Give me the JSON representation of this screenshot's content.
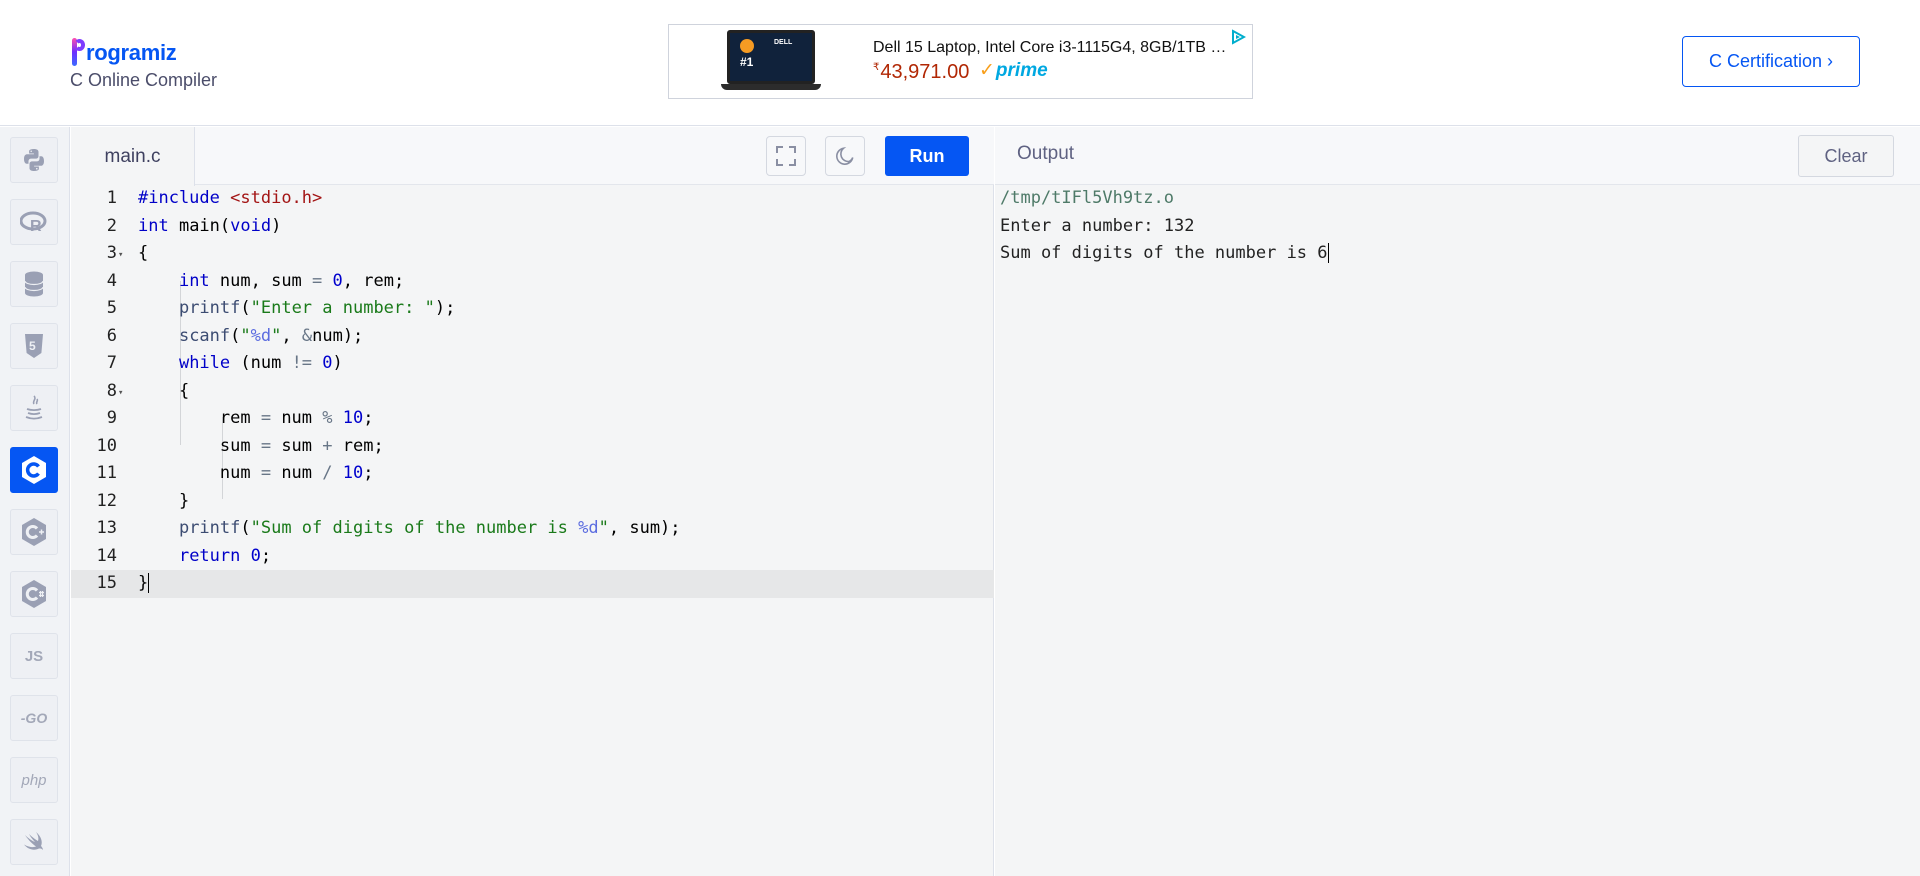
{
  "header": {
    "logo_text": "rogramiz",
    "subtitle": "C Online Compiler",
    "certification_label": "C Certification ›"
  },
  "ad": {
    "title": "Dell 15 Laptop, Intel Core i3-1115G4, 8GB/1TB …",
    "currency": "₹",
    "price": "43,971.00",
    "prime": "prime",
    "badge_text": "#1",
    "brand": "DELL"
  },
  "sidebar": {
    "languages": [
      {
        "name": "python",
        "active": false
      },
      {
        "name": "r",
        "active": false
      },
      {
        "name": "sql",
        "active": false
      },
      {
        "name": "html",
        "active": false
      },
      {
        "name": "java",
        "active": false
      },
      {
        "name": "c",
        "active": true
      },
      {
        "name": "cpp",
        "active": false
      },
      {
        "name": "csharp",
        "active": false
      },
      {
        "name": "js",
        "label": "JS",
        "active": false
      },
      {
        "name": "go",
        "label": "-GO",
        "active": false
      },
      {
        "name": "php",
        "label": "php",
        "active": false
      },
      {
        "name": "swift",
        "active": false
      }
    ]
  },
  "editor": {
    "file_name": "main.c",
    "run_label": "Run",
    "line_numbers": [
      "1",
      "2",
      "3",
      "4",
      "5",
      "6",
      "7",
      "8",
      "9",
      "10",
      "11",
      "12",
      "13",
      "14",
      "15"
    ],
    "active_line": 15
  },
  "output": {
    "title": "Output",
    "clear_label": "Clear",
    "lines": [
      "/tmp/tIFl5Vh9tz.o",
      "Enter a number: 132",
      "Sum of digits of the number is 6"
    ]
  },
  "colors": {
    "accent": "#0556f3",
    "active_line": "#e6e7e8"
  }
}
